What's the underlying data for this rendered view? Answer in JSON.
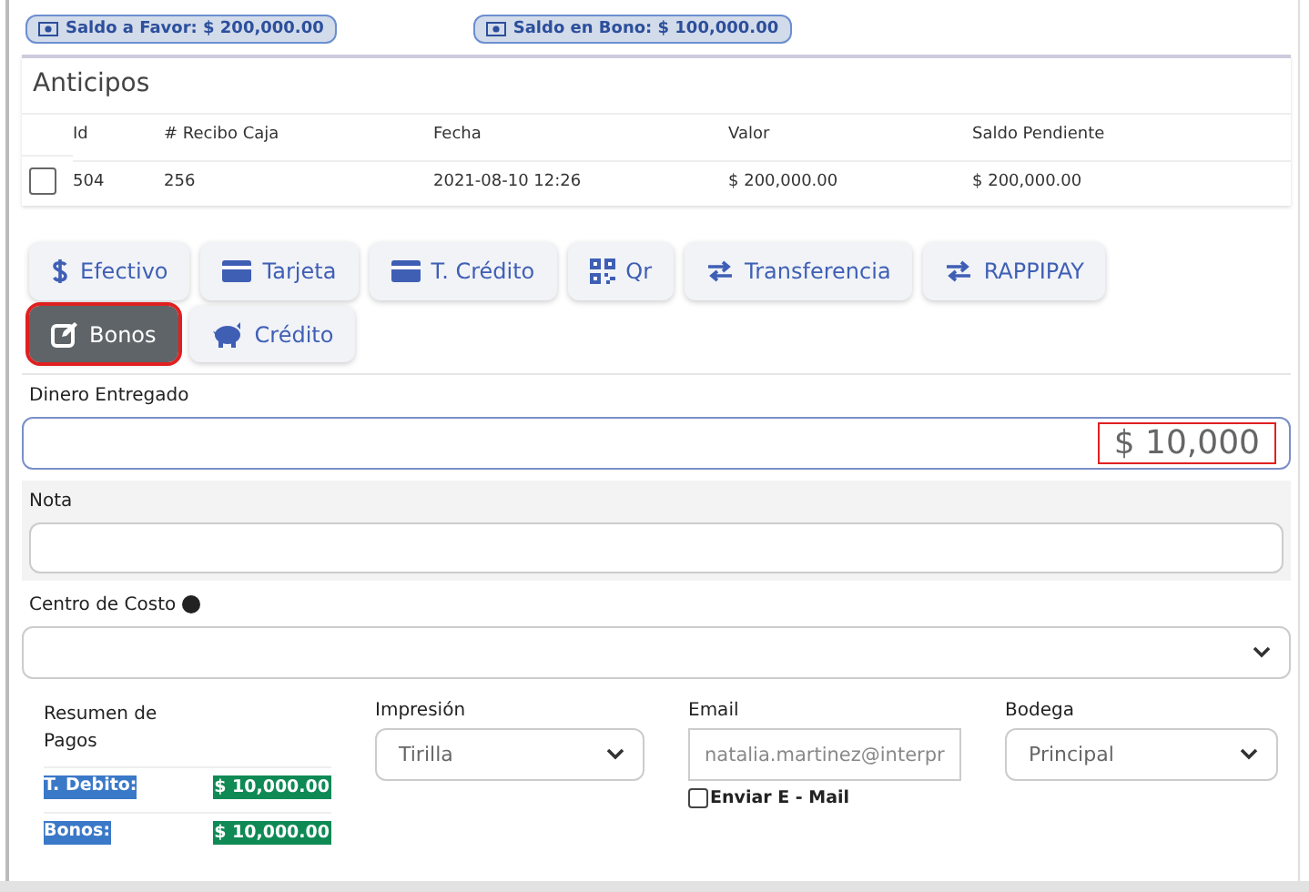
{
  "balances": [
    {
      "label": "Saldo a Favor: $ 200,000.00"
    },
    {
      "label": "Saldo en Bono: $ 100,000.00"
    }
  ],
  "advances": {
    "title": "Anticipos",
    "columns": [
      "Id",
      "# Recibo Caja",
      "Fecha",
      "Valor",
      "Saldo Pendiente"
    ],
    "rows": [
      {
        "checked": false,
        "cells": [
          "504",
          "256",
          "2021-08-10 12:26",
          "$ 200,000.00",
          "$ 200,000.00"
        ]
      }
    ]
  },
  "payment_methods": [
    {
      "label": "Efectivo",
      "kind": "cash",
      "selected": false
    },
    {
      "label": "Tarjeta",
      "kind": "card",
      "selected": false
    },
    {
      "label": "T. Crédito",
      "kind": "card",
      "selected": false
    },
    {
      "label": "Qr",
      "kind": "qr",
      "selected": false
    },
    {
      "label": "Transferencia",
      "kind": "transfer",
      "selected": false
    },
    {
      "label": "RAPPIPAY",
      "kind": "transfer",
      "selected": false
    },
    {
      "label": "Bonos",
      "kind": "voucher",
      "selected": true
    },
    {
      "label": "Crédito",
      "kind": "credit",
      "selected": false
    }
  ],
  "amount": {
    "label": "Dinero Entregado",
    "value": "$ 10,000",
    "highlighted": true
  },
  "note": {
    "label": "Nota"
  },
  "cost_center": {
    "label": "Centro de Costo"
  },
  "summary": {
    "title": "Resumen de Pagos",
    "items": [
      {
        "label": "T. Debito:",
        "value": "$ 10,000.00"
      },
      {
        "label": "Bonos:",
        "value": "$ 10,000.00"
      }
    ]
  },
  "printing": {
    "label": "Impresión",
    "value": "Tirilla"
  },
  "email": {
    "label": "Email",
    "value": "natalia.martinez@interpr",
    "send_label": "Enviar E - Mail",
    "send_checked": false
  },
  "warehouse": {
    "label": "Bodega",
    "value": "Principal"
  }
}
